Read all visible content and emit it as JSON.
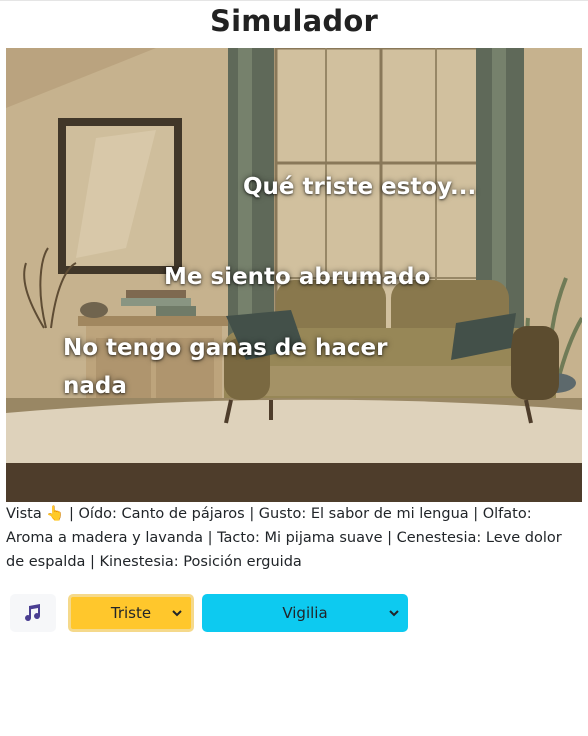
{
  "page": {
    "title": "Simulador"
  },
  "scene": {
    "thoughts": [
      "Qué triste estoy...",
      "Me siento abrumado",
      "No tengo ganas de hacer nada"
    ]
  },
  "senses": {
    "text": "Vista 👆 | Oído: Canto de pájaros | Gusto: El sabor de mi lengua | Olfato: Aroma a madera y lavanda | Tacto: Mi pijama suave | Cenestesia: Leve dolor de espalda | Kinestesia: Posición erguida"
  },
  "controls": {
    "music_icon": "music-note-icon",
    "mood_selected": "Triste",
    "state_selected": "Vigilia"
  },
  "colors": {
    "mood_bg": "#ffc72c",
    "state_bg": "#0dcaf0",
    "scene_tone": "#c9b48f"
  }
}
